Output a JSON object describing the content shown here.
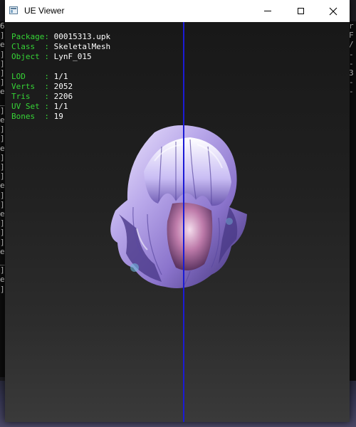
{
  "window": {
    "title": "UE Viewer",
    "controls": {
      "minimize": "minimize-icon",
      "maximize": "maximize-icon",
      "close": "close-icon"
    }
  },
  "info": {
    "package": {
      "key": "Package",
      "sep": ": ",
      "value": "00015313.upk"
    },
    "class": {
      "key": "Class  ",
      "sep": ": ",
      "value": "SkeletalMesh"
    },
    "object": {
      "key": "Object ",
      "sep": ": ",
      "value": "LynF_015"
    },
    "lod": {
      "key": "LOD    ",
      "sep": ": ",
      "value": "1/1"
    },
    "verts": {
      "key": "Verts  ",
      "sep": ": ",
      "value": "2052"
    },
    "tris": {
      "key": "Tris   ",
      "sep": ": ",
      "value": "2206"
    },
    "uvset": {
      "key": "UV Set ",
      "sep": ": ",
      "value": "1/1"
    },
    "bones": {
      "key": "Bones  ",
      "sep": ": ",
      "value": "19"
    }
  },
  "background_console": {
    "left": [
      "6",
      "]",
      "e",
      "]",
      "]",
      "]",
      "]",
      "e",
      "_",
      "]",
      "e",
      "]",
      "]",
      "e",
      "]",
      "]",
      "]",
      "e",
      "]",
      "]",
      "e",
      "]",
      "]",
      "]",
      "e",
      "_",
      "]",
      "e",
      "]"
    ],
    "right": [
      "",
      "",
      "r",
      "F",
      "/",
      "-",
      "",
      "",
      "",
      "",
      "",
      "",
      "",
      "",
      "-",
      "",
      "",
      "",
      "",
      "",
      "",
      "",
      "",
      "3",
      "-",
      "",
      "",
      "",
      "",
      "",
      "",
      "",
      "",
      "",
      "",
      "",
      "",
      "",
      "",
      "-",
      "",
      "",
      "",
      "",
      "-"
    ]
  },
  "colors": {
    "info_key": "#36d436",
    "info_value": "#ffffff",
    "axis": "#1b1bd6",
    "titlebar": "#ffffff",
    "viewport_bg": "#1e1e1e"
  }
}
